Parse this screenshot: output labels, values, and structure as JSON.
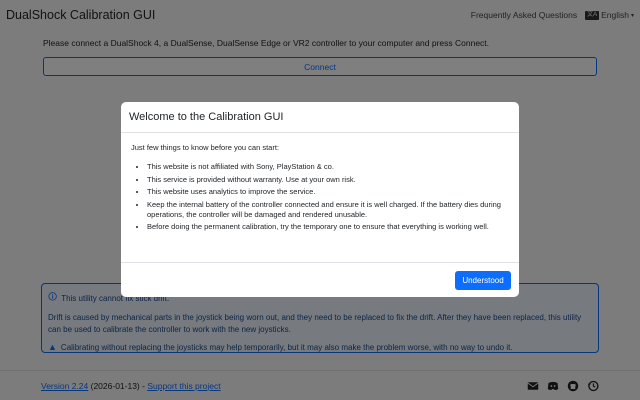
{
  "navbar": {
    "brand": "DualShock Calibration GUI",
    "faq_link": "Frequently Asked Questions",
    "language": "English",
    "language_icon": "translate-icon"
  },
  "main": {
    "intro": "Please connect a DualShock 4, a DualSense, DualSense Edge or VR2 controller to your computer and press Connect.",
    "connect_label": "Connect"
  },
  "info": {
    "heading": "This utility cannot fix stick drift.",
    "body": "Drift is caused by mechanical parts in the joystick being worn out, and they need to be replaced to fix the drift. After they have been replaced, this utility can be used to calibrate the controller to work with the new joysticks.",
    "warning": "Calibrating without replacing the joysticks may help temporarily, but it may also make the problem worse, with no way to undo it."
  },
  "footer": {
    "version_link": "Version 2.24",
    "version_date": " (2026-01-13) - ",
    "support_link": "Support this project",
    "icons": [
      "email-icon",
      "discord-icon",
      "github-icon",
      "history-icon"
    ]
  },
  "modal": {
    "title": "Welcome to the Calibration GUI",
    "intro": "Just few things to know before you can start:",
    "items": [
      "This website is not affiliated with Sony, PlayStation & co.",
      "This service is provided without warranty. Use at your own risk.",
      "This website uses analytics to improve the service.",
      "Keep the internal battery of the controller connected and ensure it is well charged. If the battery dies during operations, the controller will be damaged and rendered unusable.",
      "Before doing the permanent calibration, try the temporary one to ensure that everything is working well."
    ],
    "button": "Understood"
  },
  "colors": {
    "primary": "#0d6efd",
    "backdrop": "rgba(0,0,0,0.5)"
  }
}
